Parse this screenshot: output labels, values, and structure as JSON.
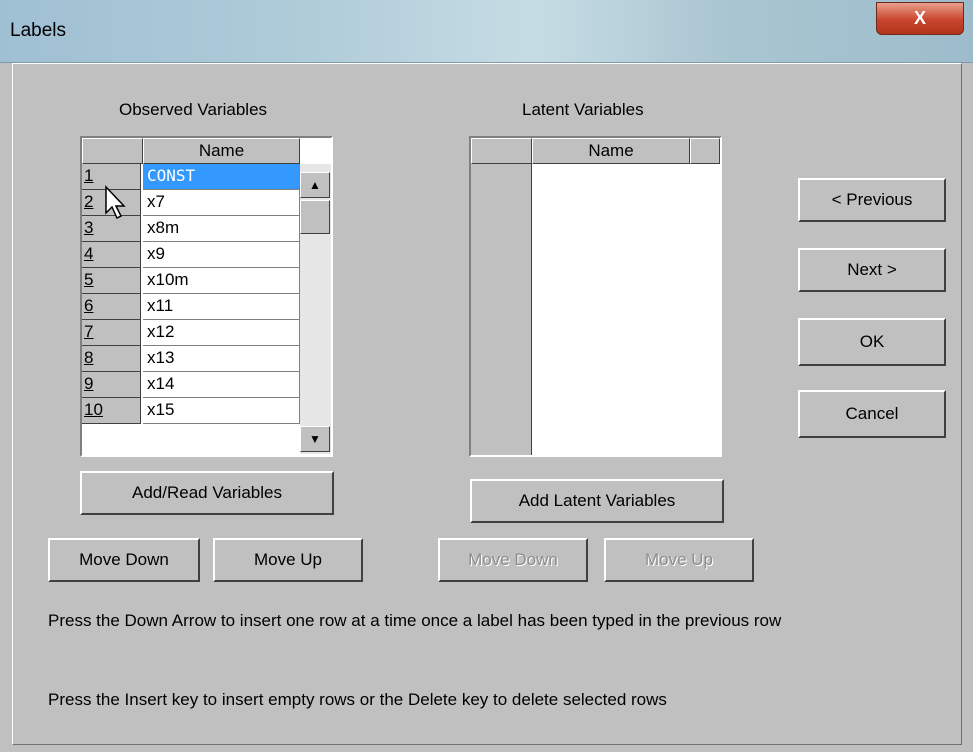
{
  "window": {
    "title": "Labels",
    "close_glyph": "X"
  },
  "observed": {
    "heading": "Observed Variables",
    "column_header": "Name",
    "rows": [
      {
        "num": "1",
        "name": "CONST"
      },
      {
        "num": "2",
        "name": "x7"
      },
      {
        "num": "3",
        "name": "x8m"
      },
      {
        "num": "4",
        "name": "x9"
      },
      {
        "num": "5",
        "name": "x10m"
      },
      {
        "num": "6",
        "name": "x11"
      },
      {
        "num": "7",
        "name": "x12"
      },
      {
        "num": "8",
        "name": "x13"
      },
      {
        "num": "9",
        "name": "x14"
      },
      {
        "num": "10",
        "name": "x15"
      }
    ],
    "add_button": "Add/Read Variables",
    "move_down": "Move Down",
    "move_up": "Move Up"
  },
  "latent": {
    "heading": "Latent Variables",
    "column_header": "Name",
    "add_button": "Add Latent Variables",
    "move_down": "Move Down",
    "move_up": "Move Up"
  },
  "nav": {
    "previous": "< Previous",
    "next": "Next >",
    "ok": "OK",
    "cancel": "Cancel"
  },
  "help": {
    "line1": "Press the Down Arrow to insert one row at a time once a label has been typed in the previous row",
    "line2": "Press the Insert key to insert empty rows or the Delete key to delete selected rows"
  },
  "icons": {
    "scroll_up": "up-arrow-icon",
    "scroll_down": "down-arrow-icon",
    "cursor": "mouse-pointer-icon"
  }
}
